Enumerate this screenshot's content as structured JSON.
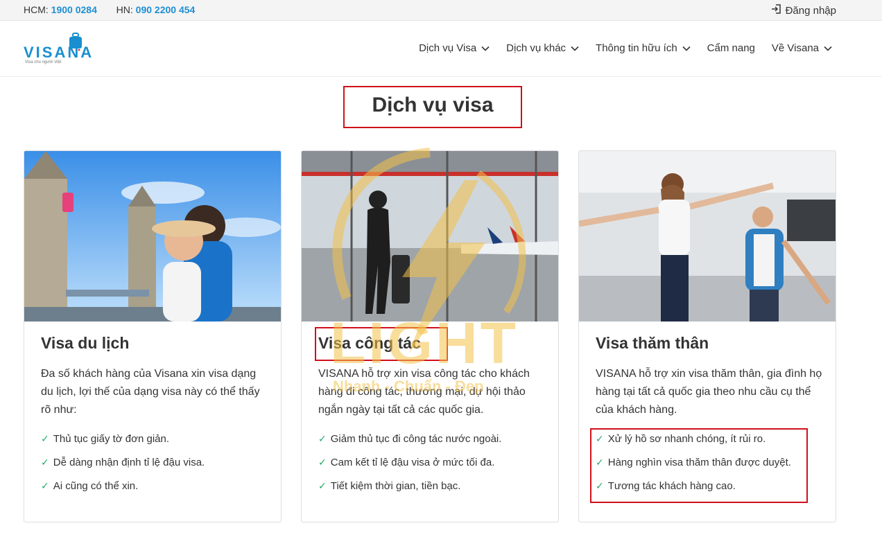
{
  "topbar": {
    "hcm_label": "HCM:",
    "hcm_phone": "1900 0284",
    "hn_label": "HN:",
    "hn_phone": "090 2200 454",
    "login": "Đăng nhập"
  },
  "logo": {
    "wordmark": "VISANA",
    "tagline": "Visa cho người Việt"
  },
  "nav": [
    {
      "label": "Dịch vụ Visa",
      "dropdown": true
    },
    {
      "label": "Dịch vụ khác",
      "dropdown": true
    },
    {
      "label": "Thông tin hữu ích",
      "dropdown": true
    },
    {
      "label": "Cẩm nang",
      "dropdown": false
    },
    {
      "label": "Về Visana",
      "dropdown": true
    }
  ],
  "section_title": "Dịch vụ visa",
  "cards": [
    {
      "title": "Visa du lịch",
      "description": "Đa số khách hàng của Visana xin visa dạng du lịch, lợi thế của dạng visa này có thể thấy rõ như:",
      "bullets": [
        "Thủ tục giấy tờ đơn giản.",
        "Dễ dàng nhận định tỉ lệ đậu visa.",
        "Ai cũng có thể xin."
      ]
    },
    {
      "title": "Visa công tác",
      "description": "VISANA hỗ trợ xin visa công tác cho khách hàng đi công tác, thương mại, dự hội thảo ngắn ngày tại tất cả các quốc gia.",
      "bullets": [
        "Giảm thủ tục đi công tác nước ngoài.",
        "Cam kết tỉ lệ đậu visa ở mức tối đa.",
        "Tiết kiệm thời gian, tiền bạc."
      ]
    },
    {
      "title": "Visa thăm thân",
      "description": "VISANA hỗ trợ xin visa thăm thân, gia đình họ hàng tại tất cả quốc gia theo nhu cầu cụ thể của khách hàng.",
      "bullets": [
        "Xử lý hồ sơ nhanh chóng, ít rủi ro.",
        "Hàng nghìn visa thăm thân được duyệt.",
        "Tương tác khách hàng cao."
      ]
    }
  ],
  "watermark": {
    "brand": "LIGHT",
    "slogan": "Nhanh - Chuẩn - Đẹp"
  },
  "colors": {
    "accent": "#1e8fd3",
    "highlight_border": "#d0101a",
    "check": "#27a86a",
    "watermark": "#f4c24a"
  }
}
